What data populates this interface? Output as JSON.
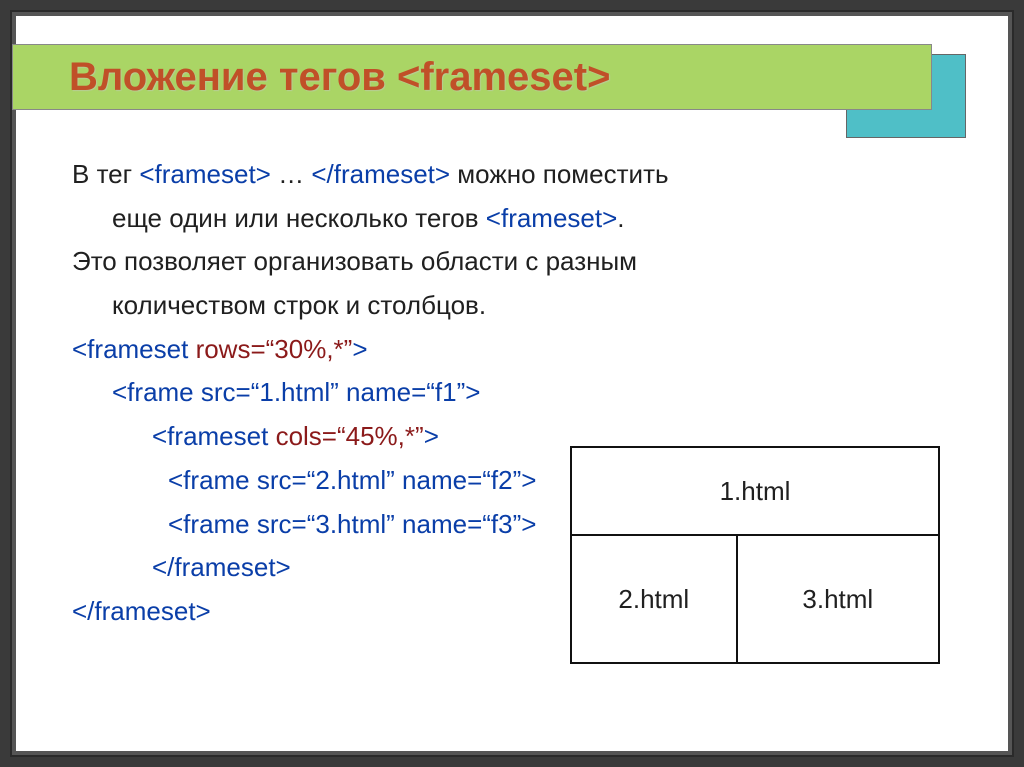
{
  "title": "Вложение тегов <frameset>",
  "para1_a": "В тег ",
  "para1_tag1": "<frameset>",
  "para1_mid": " … ",
  "para1_tag2": "</frameset>",
  "para1_b": " можно поместить",
  "para1_c": "еще один или несколько тегов ",
  "para1_tag3": "<frameset>",
  "para1_d": ".",
  "para2_a": "Это позволяет организовать области с разным",
  "para2_b": "количеством строк и столбцов.",
  "code": {
    "l1_a": "<frameset ",
    "l1_b": "rows=“30%,*”",
    "l1_c": ">",
    "l2": "<frame src=“1.html” name=“f1”>",
    "l3_a": "<frameset ",
    "l3_b": "cols=“45%,*”",
    "l3_c": ">",
    "l4": "<frame src=“2.html” name=“f2”>",
    "l5": "<frame src=“3.html” name=“f3”>",
    "l6": "</frameset>",
    "l7": "</frameset>"
  },
  "diagram": {
    "top": "1.html",
    "left": "2.html",
    "right": "3.html"
  }
}
